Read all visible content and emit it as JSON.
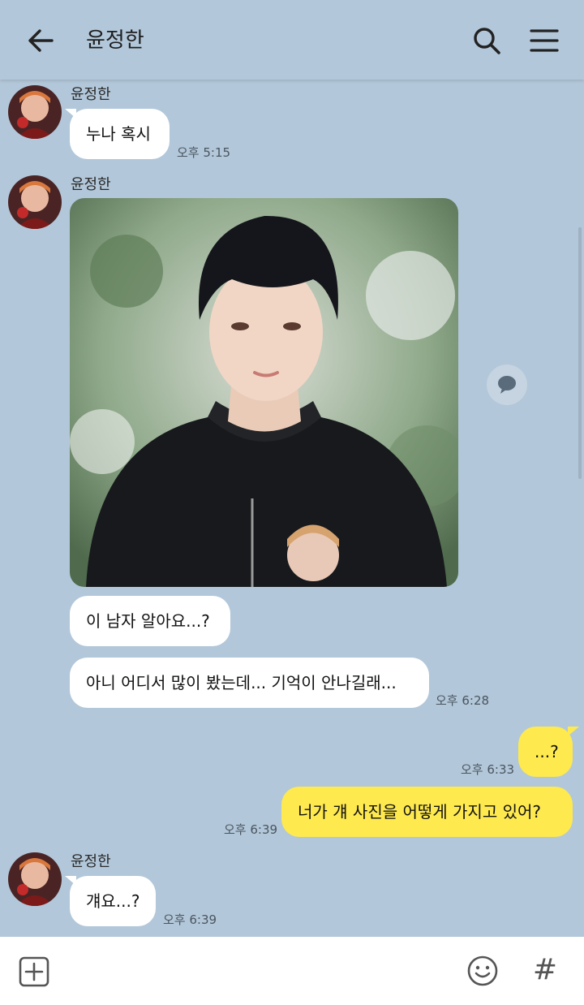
{
  "header": {
    "title": "윤정한",
    "back_icon": "arrow-left-icon",
    "search_icon": "search-icon",
    "menu_icon": "hamburger-menu-icon"
  },
  "messages": [
    {
      "sender": "윤정한",
      "text": "누나 혹시",
      "time": "오후 5:15",
      "direction": "incoming"
    },
    {
      "sender": "윤정한",
      "type": "photo",
      "direction": "incoming"
    },
    {
      "text": "이 남자 알아요...?",
      "direction": "incoming"
    },
    {
      "text": "아니 어디서 많이 봤는데... 기억이 안나길래...",
      "time": "오후 6:28",
      "direction": "incoming"
    },
    {
      "text": "...?",
      "time": "오후 6:33",
      "direction": "outgoing"
    },
    {
      "text": "너가 걔 사진을 어떻게 가지고 있어?",
      "time": "오후 6:39",
      "direction": "outgoing"
    },
    {
      "sender": "윤정한",
      "text": "걔요...?",
      "time": "오후 6:39",
      "direction": "incoming"
    }
  ],
  "input_bar": {
    "plus_icon": "plus-square-icon",
    "emoji_icon": "smiley-icon",
    "hash_label": "#"
  },
  "colors": {
    "chat_background": "#b2c7d9",
    "incoming_bubble": "#ffffff",
    "outgoing_bubble": "#fee94e"
  }
}
